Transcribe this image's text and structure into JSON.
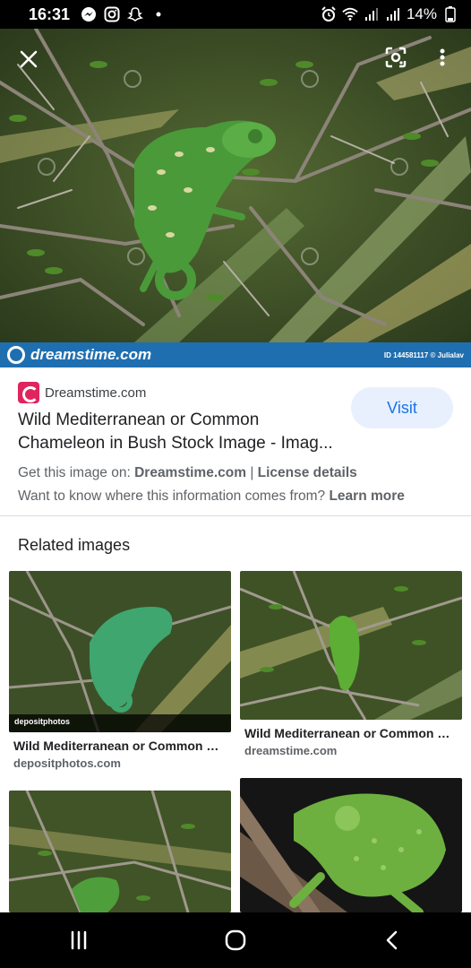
{
  "status_bar": {
    "time": "16:31",
    "battery": "14%",
    "icons": [
      "messenger-icon",
      "instagram-icon",
      "snapchat-icon",
      "dot-icon",
      "alarm-icon",
      "wifi-icon",
      "signal-icon",
      "signal-icon-2",
      "battery-icon"
    ]
  },
  "viewer": {
    "close_icon": "close-icon",
    "lens_icon": "google-lens-icon",
    "more_icon": "more-vert-icon",
    "banner_brand": "dreamstime.com",
    "banner_credit": "ID 144581117 © Julialav"
  },
  "result": {
    "source": "Dreamstime.com",
    "visit_label": "Visit",
    "title_line1": "Wild Mediterranean or Common",
    "title_line2": "Chameleon in Bush Stock Image - Imag...",
    "get_image_prefix": "Get this image on: ",
    "get_image_site": "Dreamstime.com",
    "get_image_sep": " | ",
    "license": "License details",
    "info_prefix": "Want to know where this information comes from? ",
    "learn_more": "Learn more"
  },
  "related": {
    "heading": "Related images",
    "items": [
      {
        "title": "Wild Mediterranean or Common C...",
        "source": "depositphotos.com",
        "watermark": "depositphotos"
      },
      {
        "title": "Wild Mediterranean or Common C...",
        "source": "dreamstime.com"
      },
      {
        "title": "",
        "source": ""
      },
      {
        "title": "",
        "source": ""
      }
    ]
  },
  "navbar": {
    "recents_icon": "recents-icon",
    "home_icon": "home-icon",
    "back_icon": "back-icon"
  },
  "colors": {
    "visit_bg": "#e8f0fe",
    "visit_text": "#1a73e8",
    "banner_blue": "#1f6fb0",
    "favicon_pink": "#e0245e"
  }
}
